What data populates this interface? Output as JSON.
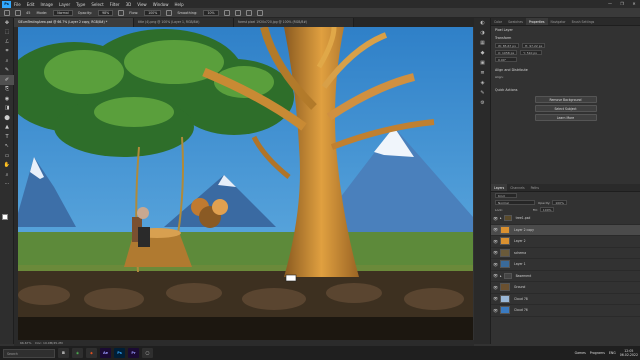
{
  "app": {
    "logo": "Ps"
  },
  "menu": [
    "File",
    "Edit",
    "Image",
    "Layer",
    "Type",
    "Select",
    "Filter",
    "3D",
    "View",
    "Window",
    "Help"
  ],
  "window_controls": [
    "—",
    "❐",
    "✕"
  ],
  "options": {
    "mode_label": "Mode:",
    "mode_value": "Normal",
    "opacity_label": "Opacity:",
    "opacity_value": "98%",
    "flow_label": "Flow:",
    "flow_value": "100%",
    "smoothing_label": "Smoothing:",
    "smoothing_value": "10%",
    "brush_size": "45"
  },
  "tabs": [
    "SiEumTestingArea.psd @ 66.7% (Layer 2 copy, RGB/8#) *",
    "title (4).png @ 100% (Layer 1, RGB/8#)",
    "forest pixel 1920x720.jpg @ 100% (RGB/8#)"
  ],
  "status": {
    "zoom": "66.67%",
    "doc": "Doc: 10.0M/45.2M"
  },
  "tools": [
    "✥",
    "⬚",
    "ℒ",
    "⌗",
    "⌕",
    "✎",
    "✐",
    "⎘",
    "◉",
    "◨",
    "⬤",
    "▲",
    "T",
    "↖",
    "▭",
    "✋",
    "⌕",
    "⋯"
  ],
  "panel_icons": [
    "◐",
    "◑",
    "▦",
    "◆",
    "▣",
    "≣",
    "◈",
    "✎",
    "⚙"
  ],
  "properties": {
    "tabs": [
      "Color",
      "Swatches",
      "Properties",
      "Navigator",
      "Brush Settings"
    ],
    "active_tab": "Properties",
    "pixel_layer": "Pixel Layer",
    "transform_title": "Transform",
    "w": "W: 85.67 px",
    "h": "H: 97.22 px",
    "x": "X: 1058 px",
    "y": "Y: 510 px",
    "angle": "0.00°",
    "align_title": "Align and Distribute",
    "align_sub": "Align:",
    "quick_title": "Quick Actions",
    "btn_remove_bg": "Remove Background",
    "btn_select_subject": "Select Subject",
    "btn_learn_more": "Learn More"
  },
  "layers_panel": {
    "tabs": [
      "Layers",
      "Channels",
      "Paths"
    ],
    "active_tab": "Layers",
    "kind": "Kind",
    "blend": "Normal",
    "opacity_label": "Opacity:",
    "opacity": "100%",
    "lock_label": "Lock:",
    "fill_label": "Fill:",
    "fill": "100%",
    "layers": [
      {
        "name": "tree1.psd",
        "kind": "group",
        "selected": false,
        "color": "#5a4a2a"
      },
      {
        "name": "Layer 2 copy",
        "kind": "layer",
        "selected": true,
        "color": "#d99030"
      },
      {
        "name": "Layer 2",
        "kind": "layer",
        "selected": false,
        "color": "#d99030"
      },
      {
        "name": "schema",
        "kind": "layer",
        "selected": false,
        "color": "#6a5a3a"
      },
      {
        "name": "Layer 1",
        "kind": "layer",
        "selected": false,
        "color": "#3a6a9a"
      },
      {
        "name": "Basement",
        "kind": "group",
        "selected": false,
        "color": "#444"
      },
      {
        "name": "Ground",
        "kind": "layer",
        "selected": false,
        "color": "#6a5030"
      },
      {
        "name": "Cloud 78",
        "kind": "layer",
        "selected": false,
        "color": "#9ab8d8"
      },
      {
        "name": "Cloud 76",
        "kind": "layer",
        "selected": false,
        "color": "#3a7ac0"
      }
    ]
  },
  "taskbar": {
    "search_placeholder": "Search",
    "apps": [
      {
        "label": "⊞",
        "bg": "#2f2f2f",
        "fg": "#ffffff"
      },
      {
        "label": "◉",
        "bg": "#2f2f2f",
        "fg": "#4caf50"
      },
      {
        "label": "◆",
        "bg": "#2f2f2f",
        "fg": "#e05020"
      },
      {
        "label": "Ae",
        "bg": "#1a0a33",
        "fg": "#9999ff"
      },
      {
        "label": "Ps",
        "bg": "#001e36",
        "fg": "#31a8ff"
      },
      {
        "label": "Pr",
        "bg": "#1a0a33",
        "fg": "#9999ff"
      },
      {
        "label": "◯",
        "bg": "#2f2f2f",
        "fg": "#cccccc"
      }
    ],
    "tray_items": [
      "Games",
      "Programs"
    ],
    "lang": "ENG",
    "time": "12:05",
    "date": "06.02.2022"
  },
  "colors": {
    "accent": "#31a8ff",
    "sky": "#3a8fd0"
  }
}
